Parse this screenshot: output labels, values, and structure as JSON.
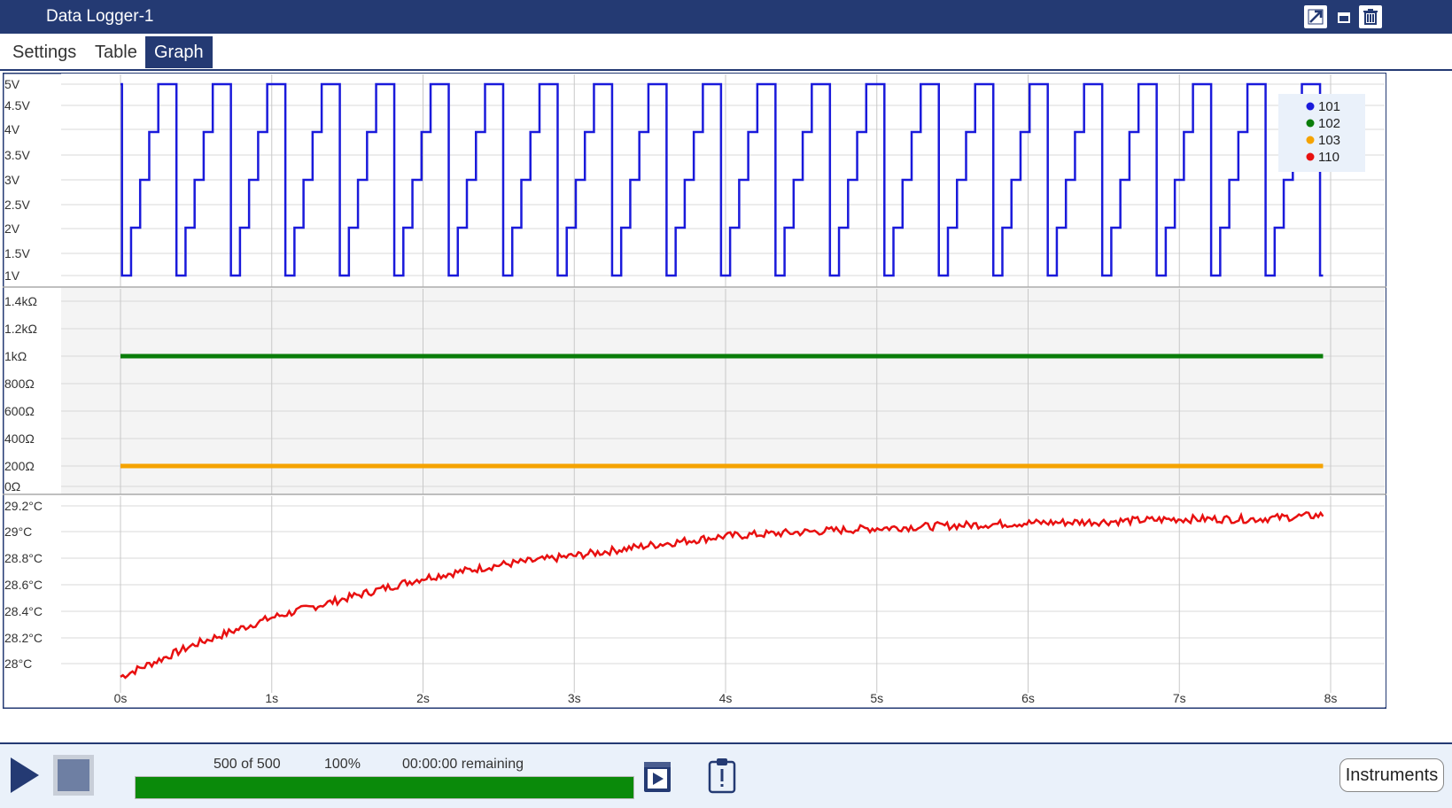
{
  "window": {
    "title": "Data Logger-1"
  },
  "tabs": [
    {
      "label": "Settings"
    },
    {
      "label": "Table"
    },
    {
      "label": "Graph"
    }
  ],
  "active_tab": "Graph",
  "icons": {
    "popout": "popout-icon",
    "maximize": "maximize-icon",
    "delete": "trash-icon",
    "play": "play-icon",
    "stop": "stop-icon",
    "book": "book-play-icon",
    "clipboard": "clipboard-alert-icon"
  },
  "colors": {
    "header": "#243a73",
    "ch101": "#1a1adb",
    "ch102": "#0a7d0a",
    "ch103": "#f5a300",
    "ch110": "#e81010",
    "progress": "#0a8a0a"
  },
  "bottom": {
    "progress_count": "500 of 500",
    "progress_percent": "100%",
    "progress_fraction": 1.0,
    "remaining": "00:00:00 remaining",
    "instruments_label": "Instruments"
  },
  "chart_data": {
    "type": "line",
    "x_ticks": [
      "0s",
      "1s",
      "2s",
      "3s",
      "4s",
      "5s",
      "6s",
      "7s",
      "8s"
    ],
    "xlim": [
      0,
      8
    ],
    "legend": {
      "placement": "top-right",
      "entries": [
        "101",
        "102",
        "103",
        "110"
      ]
    },
    "panels": [
      {
        "name": "voltage",
        "y_ticks": [
          "5V",
          "4.5V",
          "4V",
          "3.5V",
          "3V",
          "2.5V",
          "2V",
          "1.5V",
          "1V"
        ],
        "ylim": [
          1,
          5
        ],
        "series": [
          {
            "name": "101",
            "color": "#1a1adb",
            "pattern": "staircase 1V-2V-3V-4V-5V, repeating",
            "period_s": 0.36,
            "x_range": [
              0,
              7.95
            ]
          }
        ]
      },
      {
        "name": "resistance",
        "y_ticks": [
          "1.4kΩ",
          "1.2kΩ",
          "1kΩ",
          "800Ω",
          "600Ω",
          "400Ω",
          "200Ω",
          "0Ω"
        ],
        "ylim": [
          0,
          1500
        ],
        "series": [
          {
            "name": "102",
            "color": "#0a7d0a",
            "x": [
              0,
              7.95
            ],
            "y": [
              1000,
              1000
            ]
          },
          {
            "name": "103",
            "color": "#f5a300",
            "x": [
              0,
              7.95
            ],
            "y": [
              200,
              200
            ]
          }
        ]
      },
      {
        "name": "temperature",
        "y_ticks": [
          "29.2°C",
          "29°C",
          "28.8°C",
          "28.6°C",
          "28.4°C",
          "28.2°C",
          "28°C"
        ],
        "ylim": [
          27.85,
          29.25
        ],
        "series": [
          {
            "name": "110",
            "color": "#e81010",
            "x": [
              0,
              0.5,
              1,
              1.5,
              2,
              2.5,
              3,
              3.5,
              4,
              4.5,
              5,
              5.5,
              6,
              6.5,
              7,
              7.5,
              7.95
            ],
            "y": [
              27.9,
              28.15,
              28.35,
              28.5,
              28.65,
              28.75,
              28.82,
              28.9,
              28.97,
              29.0,
              29.03,
              29.05,
              29.07,
              29.08,
              29.1,
              29.1,
              29.13
            ]
          }
        ]
      }
    ]
  }
}
